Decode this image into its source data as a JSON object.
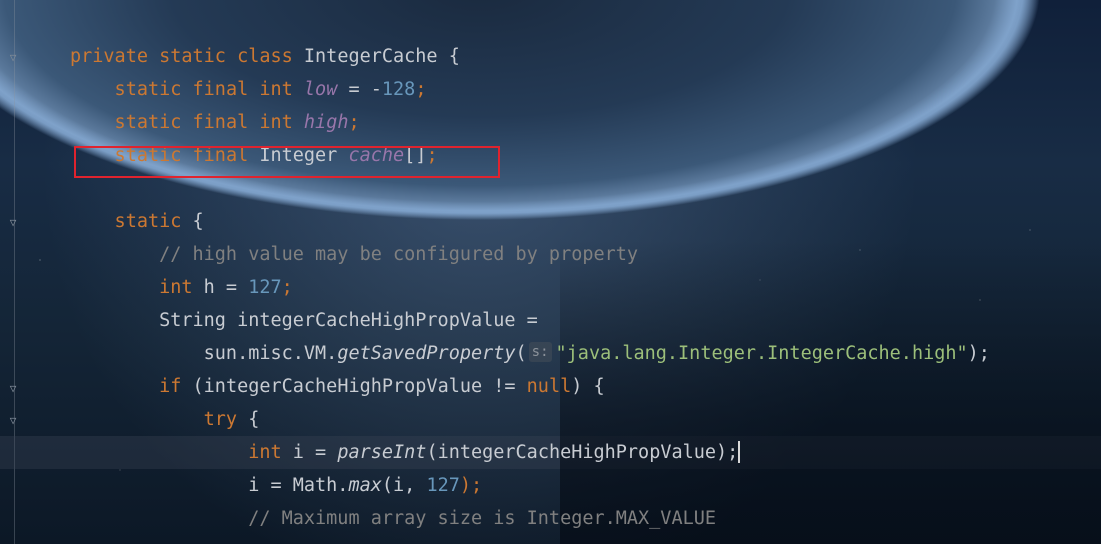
{
  "editor": {
    "highlight_color": "#e0232e",
    "lines": [
      {
        "id": "class-decl",
        "tokens": [
          {
            "t": "private ",
            "c": "kw"
          },
          {
            "t": "static ",
            "c": "kw"
          },
          {
            "t": "class ",
            "c": "kw"
          },
          {
            "t": "IntegerCache {",
            "c": "plain"
          }
        ]
      },
      {
        "id": "field-low",
        "tokens": [
          {
            "t": "    static ",
            "c": "kw"
          },
          {
            "t": "final ",
            "c": "kw"
          },
          {
            "t": "int ",
            "c": "kw"
          },
          {
            "t": "low",
            "c": "fld"
          },
          {
            "t": " = -",
            "c": "plain"
          },
          {
            "t": "128",
            "c": "num"
          },
          {
            "t": ";",
            "c": "kw"
          }
        ]
      },
      {
        "id": "field-high",
        "tokens": [
          {
            "t": "    static ",
            "c": "kw"
          },
          {
            "t": "final ",
            "c": "kw"
          },
          {
            "t": "int ",
            "c": "kw"
          },
          {
            "t": "high",
            "c": "fld"
          },
          {
            "t": ";",
            "c": "kw"
          }
        ]
      },
      {
        "id": "field-cache",
        "tokens": [
          {
            "t": "    static ",
            "c": "kw"
          },
          {
            "t": "final ",
            "c": "kw"
          },
          {
            "t": "Integer ",
            "c": "plain"
          },
          {
            "t": "cache",
            "c": "fld"
          },
          {
            "t": "[]",
            "c": "plain"
          },
          {
            "t": ";",
            "c": "kw"
          }
        ]
      },
      {
        "id": "blank",
        "tokens": []
      },
      {
        "id": "static-block",
        "tokens": [
          {
            "t": "    static ",
            "c": "kw"
          },
          {
            "t": "{",
            "c": "plain"
          }
        ]
      },
      {
        "id": "comment-high",
        "tokens": [
          {
            "t": "        // high value may be configured by property",
            "c": "cmt"
          }
        ]
      },
      {
        "id": "int-h",
        "tokens": [
          {
            "t": "        int ",
            "c": "kw"
          },
          {
            "t": "h = ",
            "c": "plain"
          },
          {
            "t": "127",
            "c": "num"
          },
          {
            "t": ";",
            "c": "kw"
          }
        ]
      },
      {
        "id": "string-decl",
        "tokens": [
          {
            "t": "        String integerCacheHighPropValue =",
            "c": "plain"
          }
        ]
      },
      {
        "id": "get-saved-property",
        "tokens": [
          {
            "t": "            sun.misc.VM.",
            "c": "plain"
          },
          {
            "t": "getSavedProperty",
            "c": "mth"
          },
          {
            "t": "(",
            "c": "plain"
          },
          {
            "hint": "s:"
          },
          {
            "t": "\"java.lang.Integer.IntegerCache.high\"",
            "c": "str2"
          },
          {
            "t": ");",
            "c": "plain"
          }
        ]
      },
      {
        "id": "if-not-null",
        "tokens": [
          {
            "t": "        if ",
            "c": "kw"
          },
          {
            "t": "(integerCacheHighPropValue != ",
            "c": "plain"
          },
          {
            "t": "null",
            "c": "kw"
          },
          {
            "t": ") {",
            "c": "plain"
          }
        ]
      },
      {
        "id": "try",
        "tokens": [
          {
            "t": "            try ",
            "c": "kw"
          },
          {
            "t": "{",
            "c": "plain"
          }
        ]
      },
      {
        "id": "parse-int",
        "tokens": [
          {
            "t": "                int ",
            "c": "kw"
          },
          {
            "t": "i = ",
            "c": "plain"
          },
          {
            "t": "parseInt",
            "c": "mth"
          },
          {
            "t": "(integerCacheHighPropValue);",
            "c": "plain"
          },
          {
            "cursor": true
          }
        ]
      },
      {
        "id": "math-max",
        "tokens": [
          {
            "t": "                i = Math.",
            "c": "plain"
          },
          {
            "t": "max",
            "c": "mth"
          },
          {
            "t": "(i, ",
            "c": "plain"
          },
          {
            "t": "127",
            "c": "num"
          },
          {
            "t": ");",
            "c": "kw"
          }
        ]
      },
      {
        "id": "comment-max",
        "tokens": [
          {
            "t": "                // Maximum array size is Integer.MAX_VALUE",
            "c": "cmt"
          }
        ]
      }
    ]
  }
}
